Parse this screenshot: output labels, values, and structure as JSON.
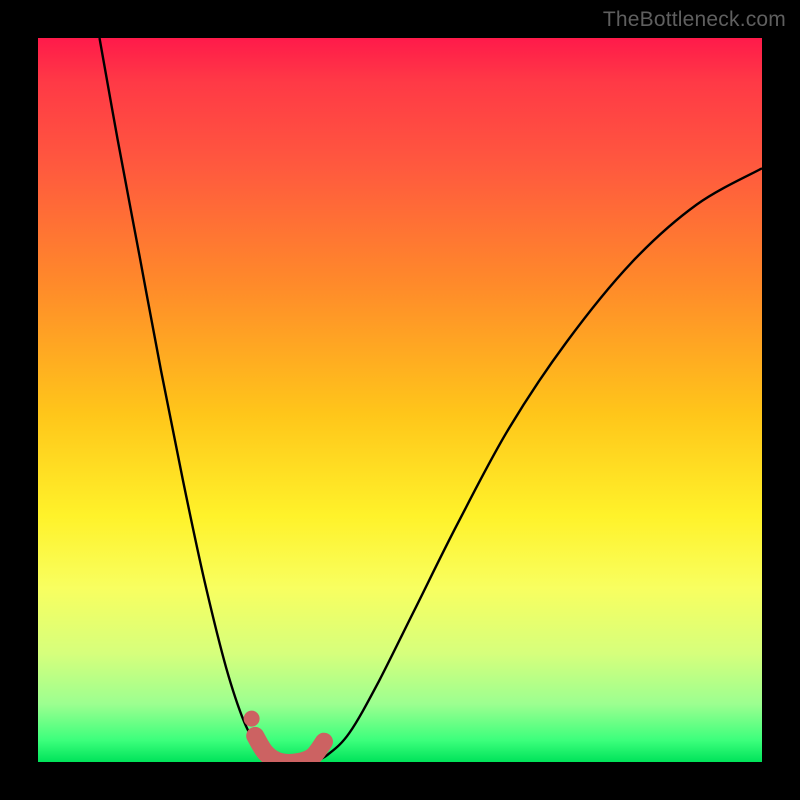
{
  "watermark": "TheBottleneck.com",
  "colors": {
    "background": "#000000",
    "curve": "#000000",
    "accent": "#cc6262",
    "gradient_top": "#ff1a4a",
    "gradient_bottom": "#00e35a"
  },
  "chart_data": {
    "type": "line",
    "title": "",
    "xlabel": "",
    "ylabel": "",
    "xlim": [
      0,
      1
    ],
    "ylim": [
      0,
      1
    ],
    "legend": false,
    "grid": false,
    "series": [
      {
        "name": "left-curve",
        "x": [
          0.085,
          0.11,
          0.14,
          0.17,
          0.2,
          0.23,
          0.26,
          0.285,
          0.305,
          0.32,
          0.33
        ],
        "y": [
          1.0,
          0.86,
          0.7,
          0.54,
          0.39,
          0.25,
          0.13,
          0.055,
          0.02,
          0.006,
          0.0
        ]
      },
      {
        "name": "right-curve",
        "x": [
          0.38,
          0.4,
          0.43,
          0.47,
          0.52,
          0.58,
          0.65,
          0.73,
          0.82,
          0.91,
          1.0
        ],
        "y": [
          0.0,
          0.01,
          0.04,
          0.11,
          0.21,
          0.33,
          0.46,
          0.58,
          0.69,
          0.77,
          0.82
        ]
      },
      {
        "name": "valley-accent",
        "x": [
          0.3,
          0.315,
          0.335,
          0.36,
          0.38,
          0.395
        ],
        "y": [
          0.036,
          0.012,
          0.0,
          0.0,
          0.008,
          0.028
        ]
      }
    ],
    "annotations": [
      {
        "name": "accent-dot",
        "x": 0.295,
        "y": 0.06
      }
    ]
  }
}
